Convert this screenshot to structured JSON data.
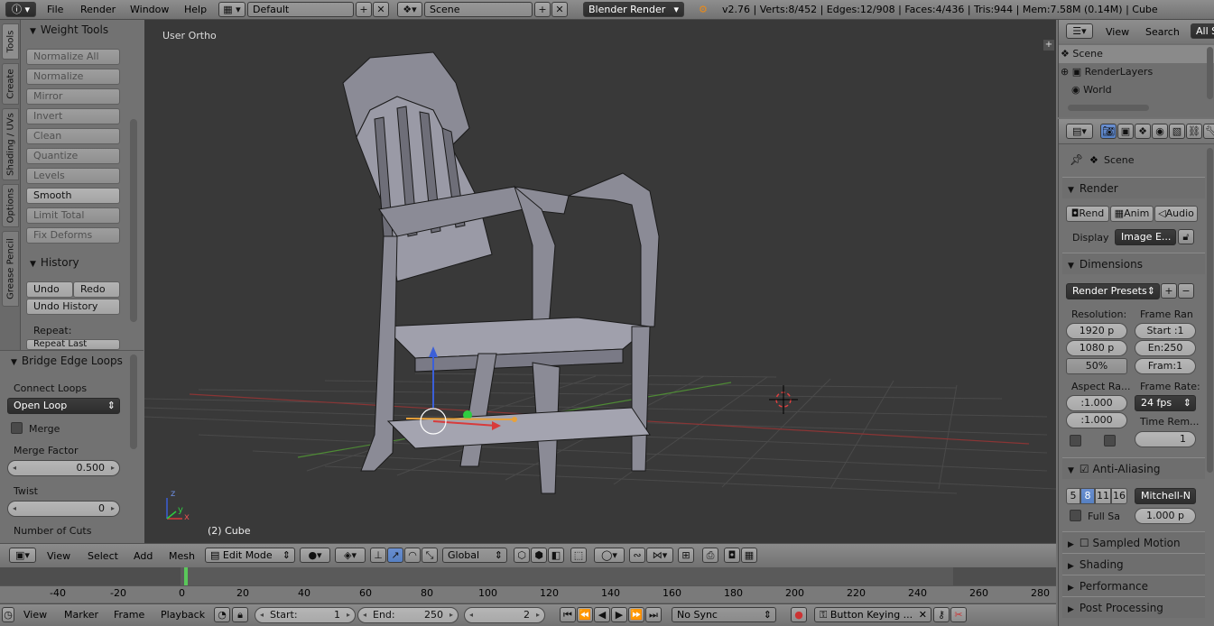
{
  "topbar": {
    "menus": [
      "File",
      "Render",
      "Window",
      "Help"
    ],
    "screen_layout": "Default",
    "scene": "Scene",
    "engine": "Blender Render",
    "stats": "v2.76 | Verts:8/452 | Edges:12/908 | Faces:4/436 | Tris:944 | Mem:7.58M (0.14M) | Cube"
  },
  "toolshelf": {
    "tabs": [
      "Tools",
      "Create",
      "Shading / UVs",
      "Options",
      "Grease Pencil"
    ],
    "weight_tools": {
      "title": "Weight Tools",
      "buttons": [
        "Normalize All",
        "Normalize",
        "Mirror",
        "Invert",
        "Clean",
        "Quantize",
        "Levels",
        "Smooth",
        "Limit Total",
        "Fix Deforms"
      ]
    },
    "history": {
      "title": "History",
      "undo": "Undo",
      "redo": "Redo",
      "undo_history": "Undo History",
      "repeat_label": "Repeat:",
      "repeat_last": "Repeat Last"
    }
  },
  "operator_panel": {
    "title": "Bridge Edge Loops",
    "connect_loops_label": "Connect Loops",
    "connect_loops_value": "Open Loop",
    "merge_label": "Merge",
    "merge_factor_label": "Merge Factor",
    "merge_factor_value": "0.500",
    "twist_label": "Twist",
    "twist_value": "0",
    "cuts_label": "Number of Cuts"
  },
  "viewport": {
    "view_label": "User Ortho",
    "object_label": "(2) Cube",
    "axis_x": "x",
    "axis_y": "y",
    "axis_z": "z"
  },
  "view3d_header": {
    "menus": [
      "View",
      "Select",
      "Add",
      "Mesh"
    ],
    "mode": "Edit Mode",
    "orientation": "Global"
  },
  "timeline": {
    "frame_numbers": [
      "-40",
      "-20",
      "0",
      "20",
      "40",
      "60",
      "80",
      "100",
      "120",
      "140",
      "160",
      "180",
      "200",
      "220",
      "240",
      "260",
      "280"
    ],
    "menus": [
      "View",
      "Marker",
      "Frame",
      "Playback"
    ],
    "start_label": "Start:",
    "start_value": "1",
    "end_label": "End:",
    "end_value": "250",
    "current_frame": "2",
    "sync": "No Sync",
    "keying": "Button Keying ..."
  },
  "outliner": {
    "menus": [
      "View",
      "Search"
    ],
    "filter": "All S",
    "items": [
      "Scene",
      "RenderLayers",
      "World"
    ]
  },
  "properties": {
    "context": "Scene",
    "render": {
      "title": "Render",
      "buttons": [
        "Rend",
        "Anim",
        "Audio"
      ],
      "display_label": "Display",
      "display_value": "Image E..."
    },
    "dimensions": {
      "title": "Dimensions",
      "presets": "Render Presets",
      "resolution_label": "Resolution:",
      "res_x": "1920 p",
      "res_y": "1080 p",
      "res_pct": "50%",
      "frame_range_label": "Frame Ran",
      "frame_start": "Start :1",
      "frame_end": "En:250",
      "frame_step": "Fram:1",
      "aspect_label": "Aspect Ra...",
      "aspect_x": ":1.000",
      "aspect_y": ":1.000",
      "frame_rate_label": "Frame Rate:",
      "fps": "24 fps",
      "time_remap_label": "Time Rem...",
      "time_remap_value": "1"
    },
    "anti_aliasing": {
      "title": "Anti-Aliasing",
      "samples": [
        "5",
        "8",
        "11",
        "16"
      ],
      "active_sample": "8",
      "filter": "Mitchell-N",
      "full_sample_label": "Full Sa",
      "filter_size": "1.000 p"
    },
    "collapsed": [
      "Sampled Motion Blur",
      "Shading",
      "Performance",
      "Post Processing"
    ]
  },
  "colors": {
    "accent_blue": "#5680c2",
    "viewport_bg": "#393939"
  }
}
